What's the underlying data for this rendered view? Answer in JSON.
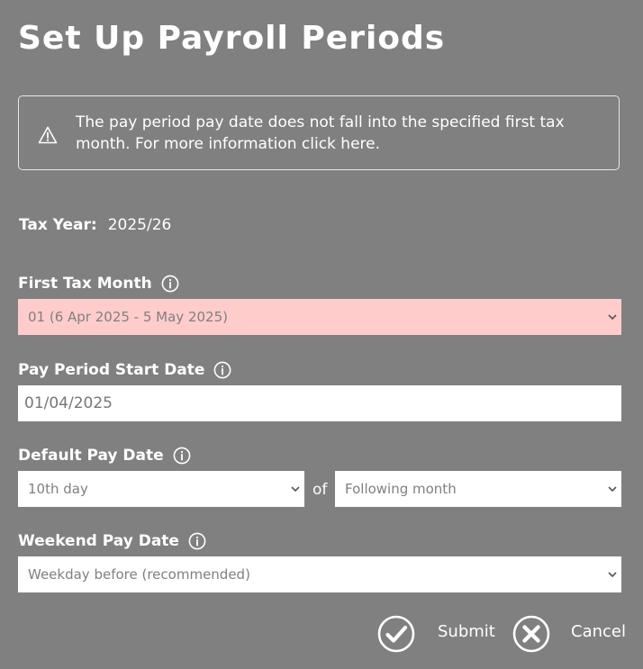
{
  "page": {
    "title": "Set Up Payroll Periods"
  },
  "alert": {
    "icon": "warning-triangle-icon",
    "message": "The pay period pay date does not fall into the specified first tax month. For more information click here."
  },
  "tax_year": {
    "label": "Tax Year:",
    "value": "2025/26"
  },
  "first_tax_month": {
    "label": "First Tax Month",
    "selected": "01 (6 Apr 2025 - 5 May 2025)",
    "state": "error",
    "error_color": "#ffcccc"
  },
  "pay_period_start": {
    "label": "Pay Period Start Date",
    "value": "01/04/2025"
  },
  "default_pay_date": {
    "label": "Default Pay Date",
    "day_selected": "10th day",
    "of_text": "of",
    "month_selected": "Following month"
  },
  "weekend_pay_date": {
    "label": "Weekend Pay Date",
    "selected": "Weekday before (recommended)"
  },
  "actions": {
    "submit_label": "Submit",
    "submit_icon": "check-circle-icon",
    "cancel_label": "Cancel",
    "cancel_icon": "x-circle-icon"
  },
  "colors": {
    "background": "#808080",
    "text": "#ffffff",
    "field_text": "#808080"
  }
}
